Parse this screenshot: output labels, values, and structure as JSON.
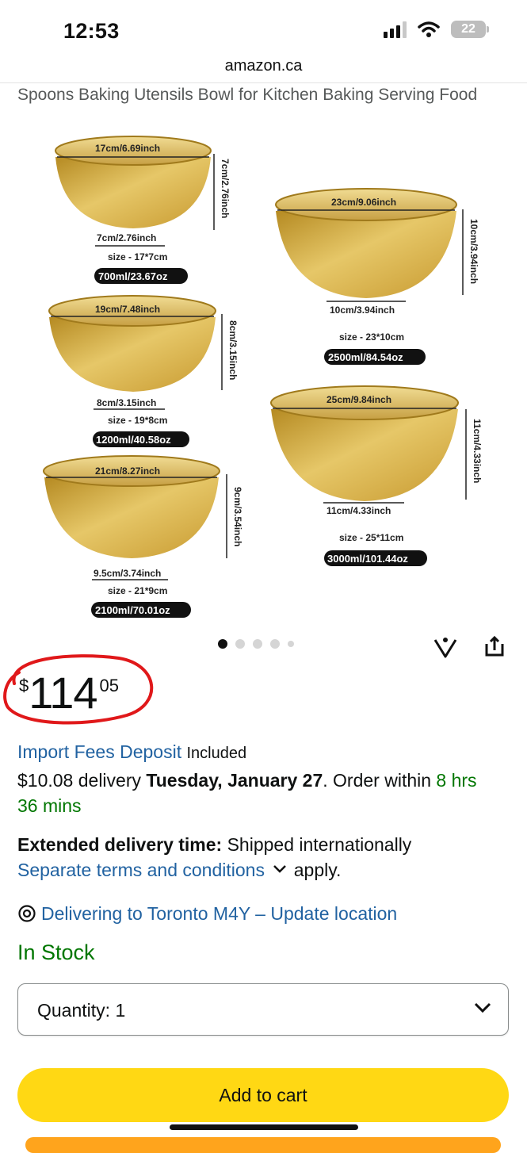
{
  "status_bar": {
    "time": "12:53",
    "battery": "22"
  },
  "browser": {
    "url": "amazon.ca"
  },
  "product": {
    "title_fragment": "Spoons Baking Utensils Bowl for Kitchen Baking Serving Food"
  },
  "gallery": {
    "bowls": [
      {
        "diameter": "17cm/6.69inch",
        "height": "7cm/2.76inch",
        "depth_label": "7cm/2.76inch",
        "size": "size - 17*7cm",
        "capacity": "700ml/23.67oz"
      },
      {
        "diameter": "19cm/7.48inch",
        "height": "8cm/3.15inch",
        "depth_label": "8cm/3.15inch",
        "size": "size - 19*8cm",
        "capacity": "1200ml/40.58oz"
      },
      {
        "diameter": "21cm/8.27inch",
        "height": "9cm/3.54inch",
        "depth_label": "9.5cm/3.74inch",
        "size": "size - 21*9cm",
        "capacity": "2100ml/70.01oz"
      },
      {
        "diameter": "23cm/9.06inch",
        "height": "10cm/3.94inch",
        "depth_label": "10cm/3.94inch",
        "size": "size - 23*10cm",
        "capacity": "2500ml/84.54oz"
      },
      {
        "diameter": "25cm/9.84inch",
        "height": "11cm/4.33inch",
        "depth_label": "11cm/4.33inch",
        "size": "size - 25*11cm",
        "capacity": "3000ml/101.44oz"
      }
    ],
    "dots_total": 5,
    "dots_active": 1
  },
  "price": {
    "symbol": "$",
    "whole": "114",
    "fraction": "05"
  },
  "import_fees": {
    "link": "Import Fees Deposit",
    "suffix": "Included"
  },
  "delivery": {
    "prefix": "$10.08 delivery",
    "date": "Tuesday, January 27",
    "order_within_text": ". Order within",
    "countdown": "8 hrs 36 mins"
  },
  "extended": {
    "label": "Extended delivery time:",
    "value": "Shipped internationally",
    "terms_link": "Separate terms and conditions",
    "terms_suffix": "apply."
  },
  "location": {
    "text": "Delivering to Toronto M4Y – Update location"
  },
  "stock": "In Stock",
  "quantity": {
    "label": "Quantity:",
    "value": "1"
  },
  "add_to_cart": "Add to cart",
  "colors": {
    "gold": "#d9b44a",
    "yellow_button": "#ffd814",
    "link_blue": "#2162a1",
    "green": "#007600"
  }
}
